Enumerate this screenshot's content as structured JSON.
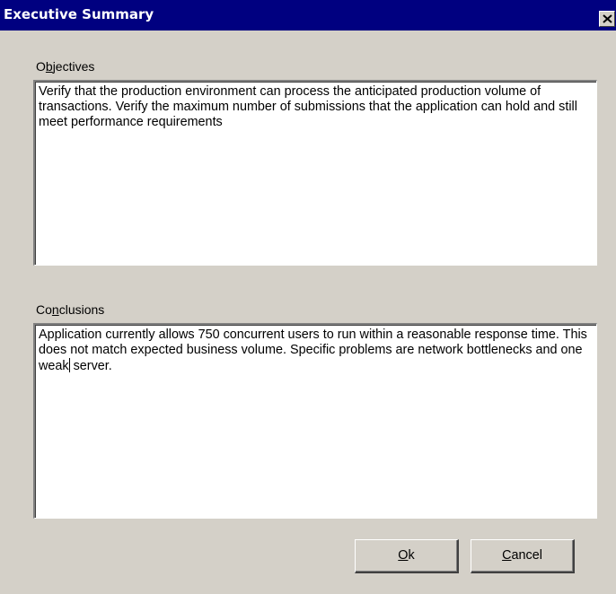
{
  "window": {
    "title": "Executive Summary"
  },
  "objectives": {
    "label_pre": "O",
    "label_accel": "b",
    "label_post": "jectives",
    "text": "Verify that the production environment can process the anticipated production volume of transactions. Verify the maximum number of submissions that the application can hold and still meet performance requirements"
  },
  "conclusions": {
    "label_pre": "Co",
    "label_accel": "n",
    "label_post": "clusions",
    "text_before_caret": "Application currently allows 750 concurrent users to run within a reasonable response time. This does not match expected business volume. Specific problems are network bottlenecks and one weak",
    "text_after_caret": " server."
  },
  "buttons": {
    "ok_accel": "O",
    "ok_rest": "k",
    "cancel_accel": "C",
    "cancel_rest": "ancel"
  },
  "icons": {
    "close": "close-icon"
  }
}
